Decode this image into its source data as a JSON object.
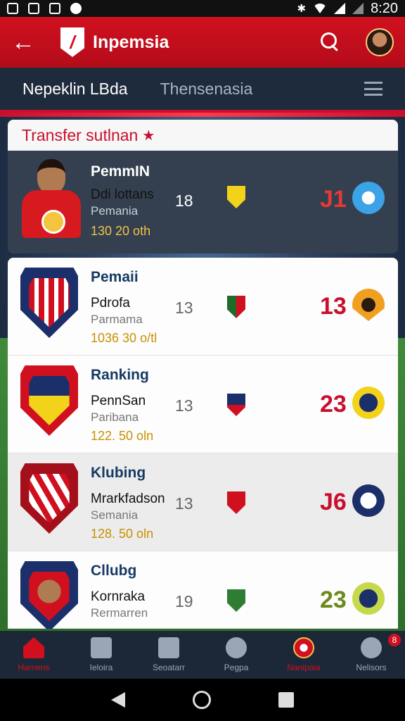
{
  "status_bar": {
    "time": "8:20"
  },
  "app_bar": {
    "title": "Inpemsia",
    "logo_letter": "/"
  },
  "tabs": [
    {
      "label": "Nepeklin LBda",
      "active": true
    },
    {
      "label": "Thensenasia",
      "active": false
    }
  ],
  "card": {
    "header": "Transfer sutlnan",
    "header_icon": "star-icon",
    "featured": {
      "title": "PemmIN",
      "name": "Ddi lottans",
      "sub": "Pemania",
      "price": "130 20 oth",
      "num": "18",
      "score": "J1"
    }
  },
  "rows": [
    {
      "title": "Pemaii",
      "name": "Pdrofa",
      "sub": "Parmama",
      "price": "1036 30 o/tl",
      "num": "13",
      "score": "13"
    },
    {
      "title": "Ranking",
      "name": "PennSan",
      "sub": "Paribana",
      "price": "122. 50 oln",
      "num": "13",
      "score": "23"
    },
    {
      "title": "Klubing",
      "name": "Mrarkfadson",
      "sub": "Semania",
      "price": "128. 50 oln",
      "num": "13",
      "score": "J6"
    },
    {
      "title": "Cllubg",
      "name": "Kornraka",
      "sub": "Rermarren",
      "price": "",
      "num": "19",
      "score": "23"
    }
  ],
  "bottom_nav": [
    {
      "label": "Harnens",
      "active": true,
      "icon": "home-icon"
    },
    {
      "label": "Ieloira",
      "active": false,
      "icon": "hammer-icon"
    },
    {
      "label": "Seoatarr",
      "active": false,
      "icon": "trophy-icon"
    },
    {
      "label": "Pegpa",
      "active": false,
      "icon": "ball-icon"
    },
    {
      "label": "Nanipaia",
      "active": true,
      "icon": "team-icon"
    },
    {
      "label": "Nelisors",
      "active": false,
      "icon": "chat-icon",
      "badge": "8"
    }
  ],
  "colors": {
    "accent": "#d0101f",
    "navy": "#1e2b3d",
    "gold": "#c79000"
  }
}
